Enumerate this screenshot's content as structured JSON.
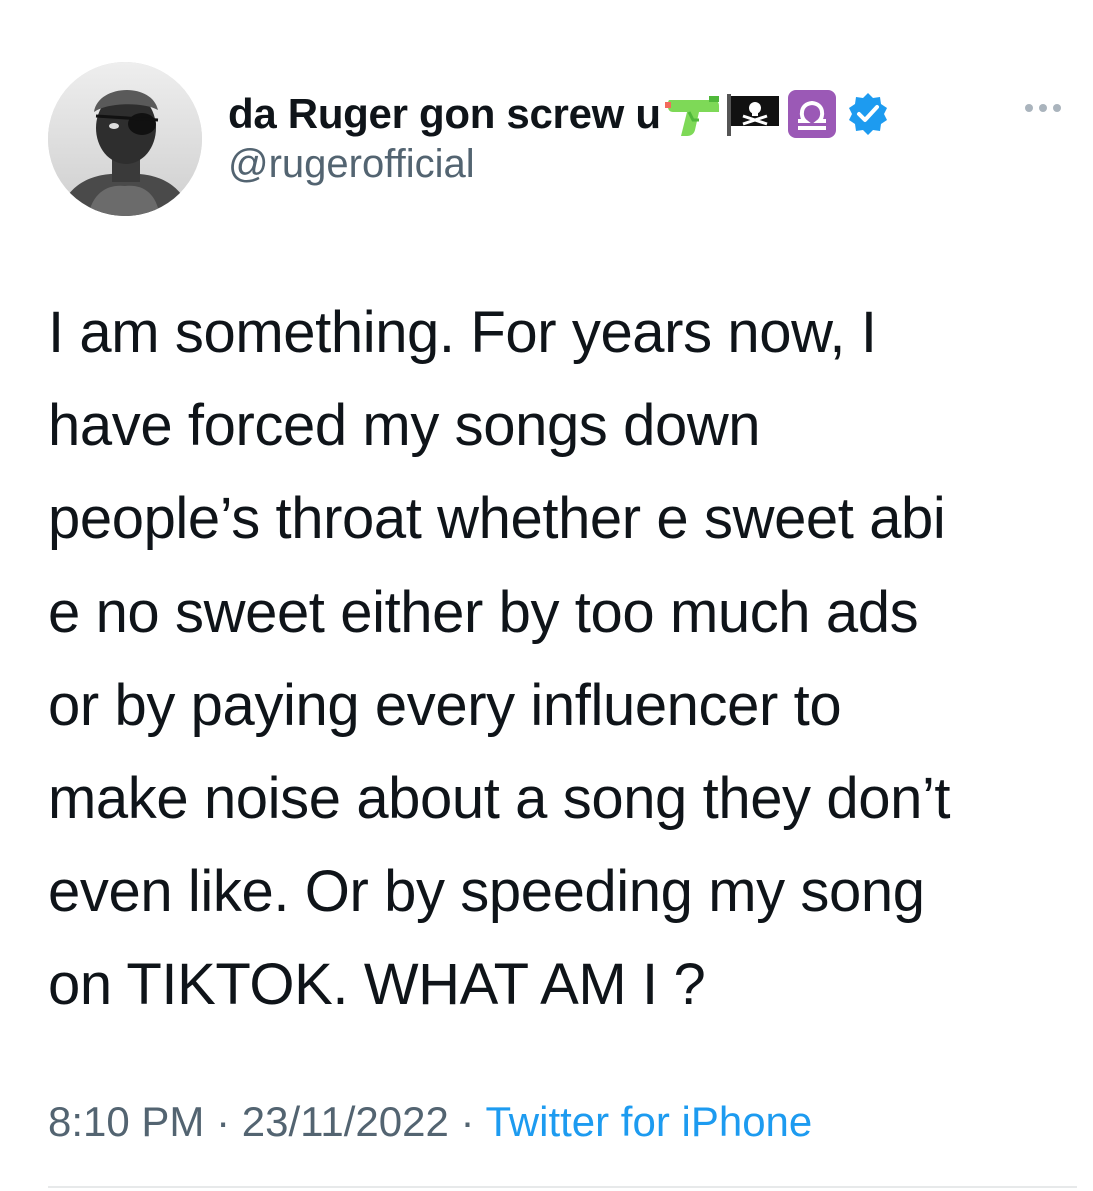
{
  "author": {
    "display_name": "da Ruger gon screw u",
    "handle": "@rugerofficial",
    "name_emojis": [
      "water-pistol-icon",
      "pirate-flag-icon",
      "libra-icon"
    ],
    "verified": true
  },
  "tweet": {
    "text_lines": [
      "I am something. For years now, I",
      "have forced my songs down",
      "people’s throat whether e sweet abi",
      "e no sweet either by too much ads",
      "or by paying every influencer to",
      "make noise about a song they don’t",
      "even like. Or by speeding my song",
      "on TIKTOK. WHAT AM I ?"
    ],
    "time": "8:10 PM",
    "separator": "·",
    "date": "23/11/2022",
    "source": "Twitter for iPhone"
  },
  "colors": {
    "text": "#0f1419",
    "secondary": "#536471",
    "link": "#1d9bf0",
    "verified": "#1d9bf0",
    "libra_bg": "#9b59b6"
  }
}
